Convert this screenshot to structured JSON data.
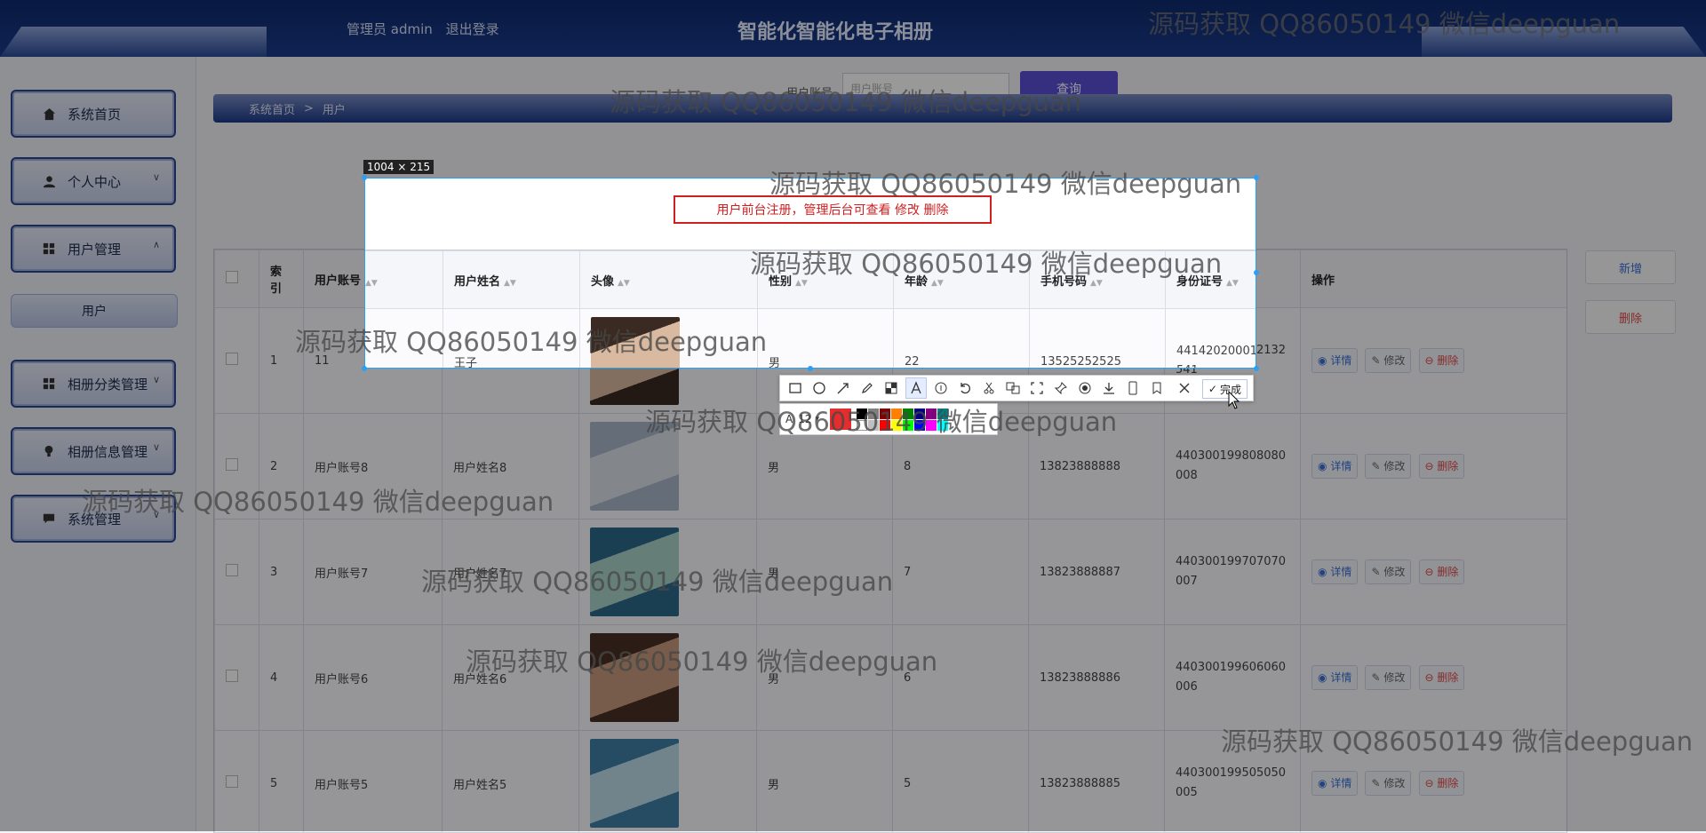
{
  "header": {
    "user_label": "管理员 admin",
    "logout": "退出登录",
    "title": "智能化智能化电子相册"
  },
  "sidebar": {
    "items": [
      {
        "label": "系统首页",
        "icon": "home-icon"
      },
      {
        "label": "个人中心",
        "icon": "user-icon"
      },
      {
        "label": "用户管理",
        "icon": "grid-icon"
      },
      {
        "label": "相册分类管理",
        "icon": "grid-icon"
      },
      {
        "label": "相册信息管理",
        "icon": "bulb-icon"
      },
      {
        "label": "系统管理",
        "icon": "chat-icon"
      }
    ],
    "sub_item": "用户"
  },
  "search": {
    "label": "用户账号",
    "placeholder": "用户账号",
    "button": "查询"
  },
  "breadcrumb": {
    "home": "系统首页",
    "sep": ">",
    "current": "用户"
  },
  "table": {
    "headers": {
      "index": "索引",
      "account": "用户账号",
      "name": "用户姓名",
      "avatar": "头像",
      "gender": "性别",
      "age": "年龄",
      "phone": "手机号码",
      "id_card": "身份证号",
      "actions": "操作"
    },
    "rows": [
      {
        "index": "1",
        "account": "11",
        "name": "王子",
        "gender": "男",
        "age": "22",
        "phone": "13525252525",
        "id_card": "441420200012132541"
      },
      {
        "index": "2",
        "account": "用户账号8",
        "name": "用户姓名8",
        "gender": "男",
        "age": "8",
        "phone": "13823888888",
        "id_card": "440300199808080008"
      },
      {
        "index": "3",
        "account": "用户账号7",
        "name": "用户姓名7",
        "gender": "男",
        "age": "7",
        "phone": "13823888887",
        "id_card": "440300199707070007"
      },
      {
        "index": "4",
        "account": "用户账号6",
        "name": "用户姓名6",
        "gender": "男",
        "age": "6",
        "phone": "13823888886",
        "id_card": "440300199606060006"
      },
      {
        "index": "5",
        "account": "用户账号5",
        "name": "用户姓名5",
        "gender": "男",
        "age": "5",
        "phone": "13823888885",
        "id_card": "440300199505050005"
      }
    ],
    "action_labels": {
      "detail": "详情",
      "edit": "修改",
      "delete": "删除"
    }
  },
  "side_buttons": {
    "add": "新增",
    "delete": "删除"
  },
  "screenshot_tool": {
    "size_label": "1004 × 215",
    "note": "用户前台注册，管理后台可查看 修改 删除",
    "done": "完成",
    "font_size": "12"
  },
  "watermark": "源码获取 QQ86050149 微信deepguan"
}
